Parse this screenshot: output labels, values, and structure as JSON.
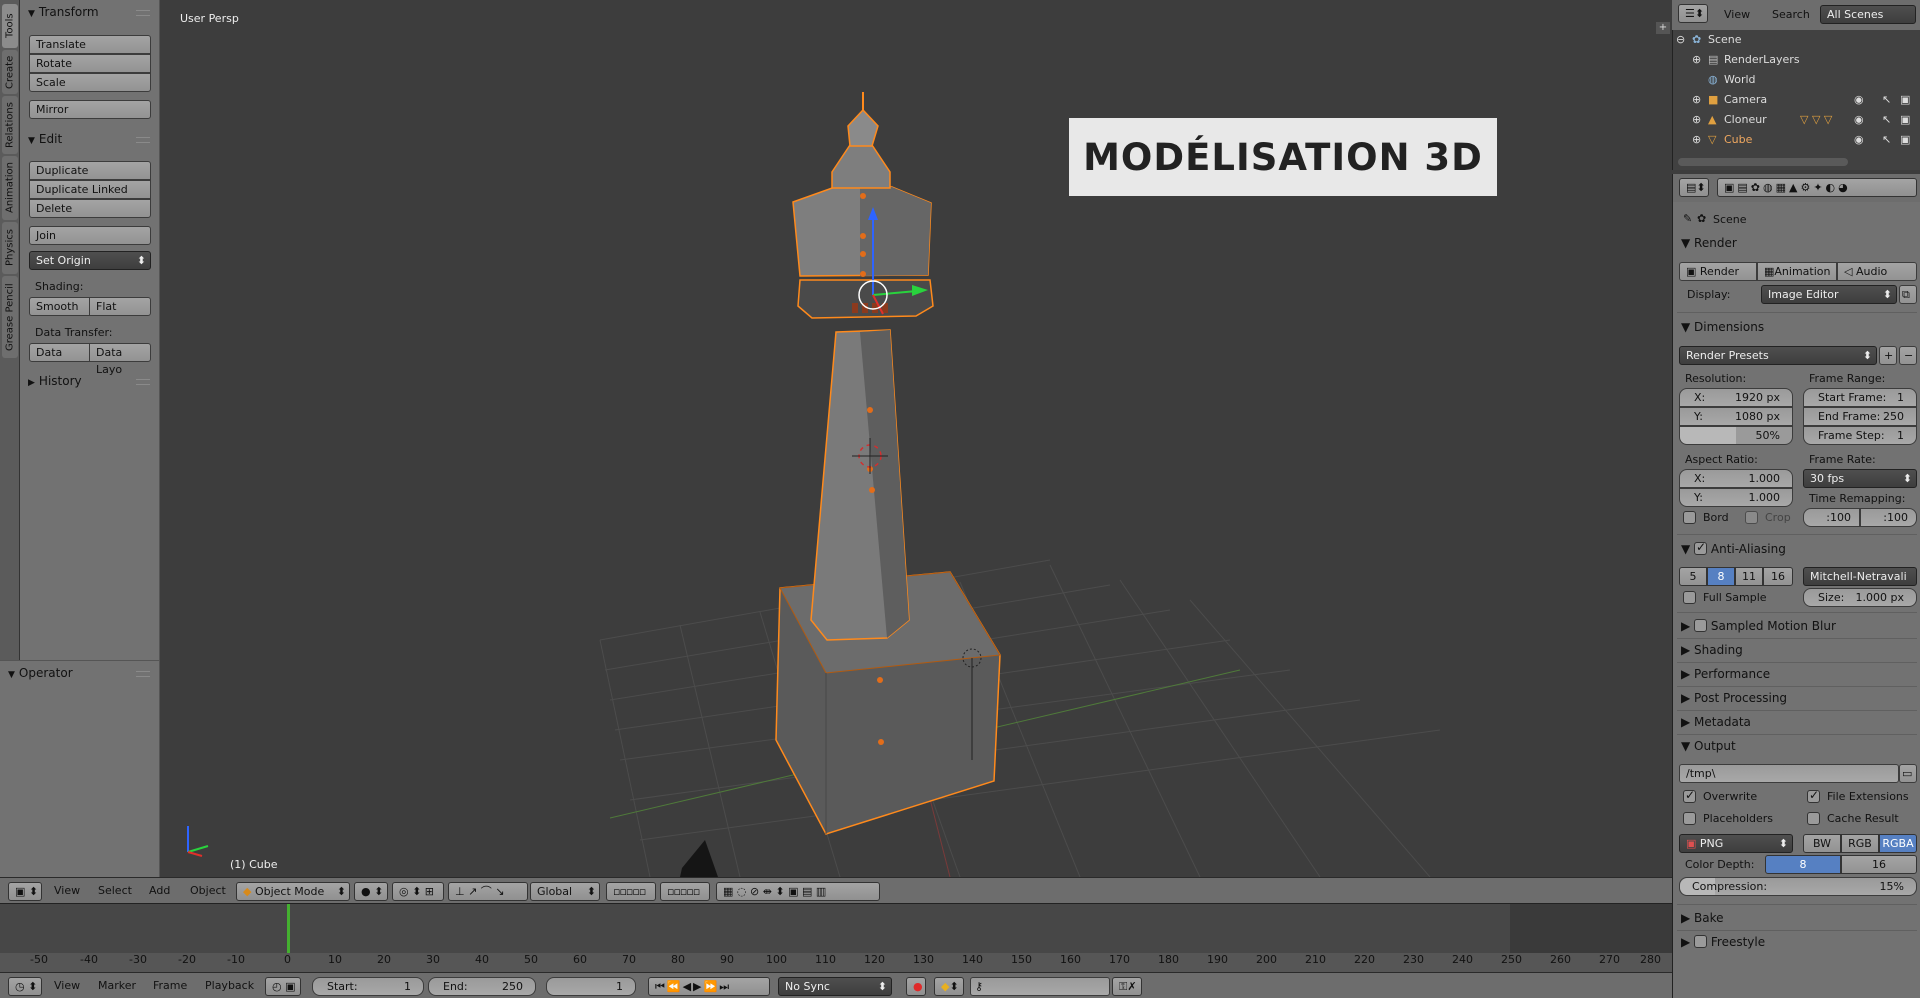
{
  "viewport": {
    "view_label": "User Persp",
    "object_label": "(1) Cube",
    "overlay_title": "MODÉLISATION 3D"
  },
  "tabs": [
    "Tools",
    "Create",
    "Relations",
    "Animation",
    "Physics",
    "Grease Pencil"
  ],
  "tool_shelf": {
    "transform": {
      "title": "Transform",
      "buttons": [
        "Translate",
        "Rotate",
        "Scale",
        "Mirror"
      ]
    },
    "edit": {
      "title": "Edit",
      "buttons": [
        "Duplicate",
        "Duplicate Linked",
        "Delete",
        "Join"
      ],
      "set_origin": "Set Origin",
      "shading_label": "Shading:",
      "smooth": "Smooth",
      "flat": "Flat",
      "data_transfer_label": "Data Transfer:",
      "data": "Data",
      "data_layo": "Data Layo"
    },
    "history": "History",
    "operator": "Operator"
  },
  "view3d_header": {
    "menus": [
      "View",
      "Select",
      "Add",
      "Object"
    ],
    "mode": "Object Mode",
    "orientation": "Global"
  },
  "timeline": {
    "ticks": [
      "-50",
      "-40",
      "-30",
      "-20",
      "-10",
      "0",
      "10",
      "20",
      "30",
      "40",
      "50",
      "60",
      "70",
      "80",
      "90",
      "100",
      "110",
      "120",
      "130",
      "140",
      "150",
      "160",
      "170",
      "180",
      "190",
      "200",
      "210",
      "220",
      "230",
      "240",
      "250",
      "260",
      "270",
      "280"
    ],
    "menus": [
      "View",
      "Marker",
      "Frame",
      "Playback"
    ],
    "start_label": "Start:",
    "start": "1",
    "end_label": "End:",
    "end": "250",
    "current": "1",
    "sync": "No Sync"
  },
  "outliner": {
    "menus": [
      "View",
      "Search"
    ],
    "scope": "All Scenes",
    "rows": [
      "Scene",
      "RenderLayers",
      "World",
      "Camera",
      "Cloneur",
      "Cube"
    ]
  },
  "properties": {
    "scene": "Scene",
    "render_panel": "Render",
    "render_buttons": [
      "Render",
      "Animation",
      "Audio"
    ],
    "display_label": "Display:",
    "display": "Image Editor",
    "dimensions": "Dimensions",
    "render_presets": "Render Presets",
    "resolution_label": "Resolution:",
    "res_x": "X:",
    "res_x_val": "1920 px",
    "res_y": "Y:",
    "res_y_val": "1080 px",
    "res_pct": "50%",
    "frame_range_label": "Frame Range:",
    "start_frame": "Start Frame:",
    "start_frame_val": "1",
    "end_frame": "End Frame:",
    "end_frame_val": "250",
    "frame_step": "Frame Step:",
    "frame_step_val": "1",
    "aspect_label": "Aspect Ratio:",
    "asp_x": "X:",
    "asp_x_val": "1.000",
    "asp_y": "Y:",
    "asp_y_val": "1.000",
    "frame_rate_label": "Frame Rate:",
    "frame_rate": "30 fps",
    "time_remap_label": "Time Remapping:",
    "remap_old": ":100",
    "remap_new": ":100",
    "bord": "Bord",
    "crop": "Crop",
    "anti_aliasing": "Anti-Aliasing",
    "aa_samples": [
      "5",
      "8",
      "11",
      "16"
    ],
    "aa_filter": "Mitchell-Netravali",
    "full_sample": "Full Sample",
    "size_label": "Size:",
    "size_val": "1.000 px",
    "collapsed": [
      "Sampled Motion Blur",
      "Shading",
      "Performance",
      "Post Processing",
      "Metadata"
    ],
    "output": "Output",
    "output_path": "/tmp\\",
    "overwrite": "Overwrite",
    "file_ext": "File Extensions",
    "placeholders": "Placeholders",
    "cache_result": "Cache Result",
    "format": "PNG",
    "color_modes": [
      "BW",
      "RGB",
      "RGBA"
    ],
    "color_depth_label": "Color Depth:",
    "depths": [
      "8",
      "16"
    ],
    "compression_label": "Compression:",
    "compression": "15%",
    "compression_value": 0.15,
    "bake": "Bake",
    "freestyle": "Freestyle"
  }
}
